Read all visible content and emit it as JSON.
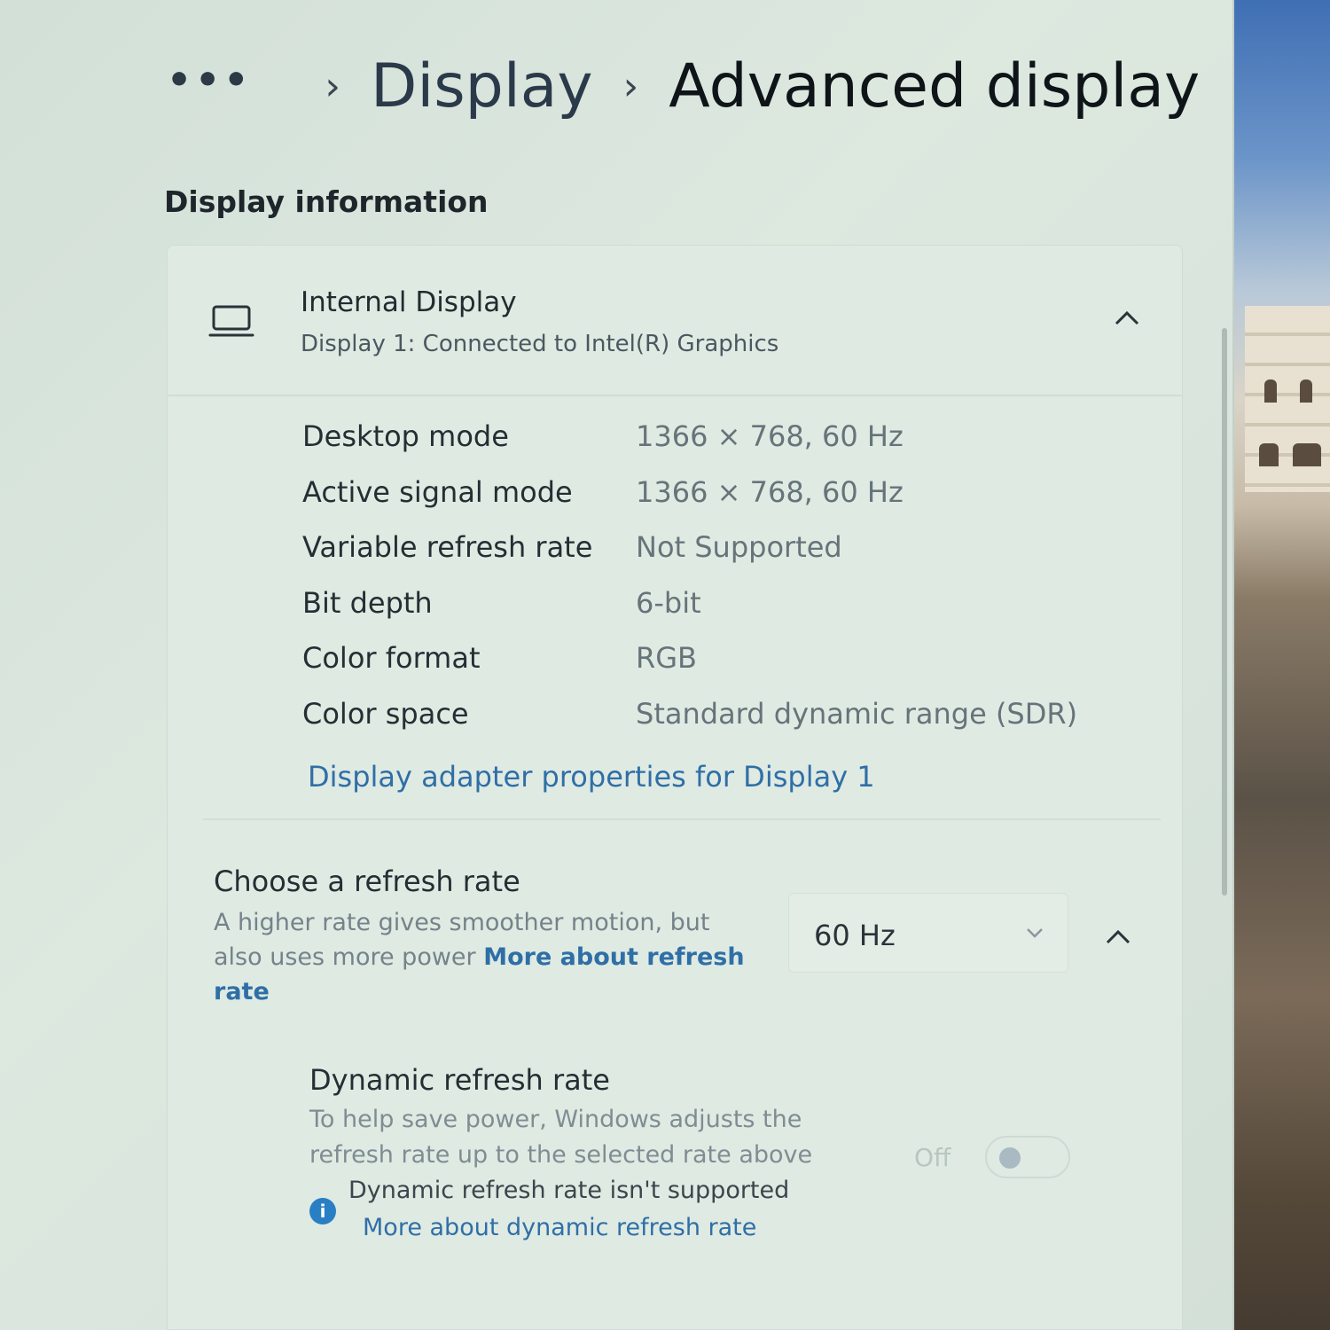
{
  "breadcrumb": {
    "more": "•••",
    "sep": "›",
    "items": [
      "Display",
      "Advanced display"
    ]
  },
  "section_title": "Display information",
  "display": {
    "name": "Internal Display",
    "subtitle": "Display 1: Connected to Intel(R) Graphics",
    "icon": "laptop-icon",
    "rows": [
      {
        "label": "Desktop mode",
        "value": "1366 × 768, 60 Hz"
      },
      {
        "label": "Active signal mode",
        "value": "1366 × 768, 60 Hz"
      },
      {
        "label": "Variable refresh rate",
        "value": "Not Supported"
      },
      {
        "label": "Bit depth",
        "value": "6-bit"
      },
      {
        "label": "Color format",
        "value": "RGB"
      },
      {
        "label": "Color space",
        "value": "Standard dynamic range (SDR)"
      }
    ],
    "adapter_link": "Display adapter properties for Display 1"
  },
  "refresh": {
    "title": "Choose a refresh rate",
    "desc": "A higher rate gives smoother motion, but also uses more power",
    "link": "More about refresh rate",
    "selected": "60 Hz"
  },
  "dynamic": {
    "title": "Dynamic refresh rate",
    "desc": "To help save power, Windows adjusts the refresh rate up to the selected rate above",
    "toggle_label": "Off",
    "toggle_on": false,
    "info_text": "Dynamic refresh rate isn't supported",
    "info_link": "More about dynamic refresh rate"
  },
  "colors": {
    "link": "#2f6fa6",
    "info_icon": "#2a7fc4"
  }
}
